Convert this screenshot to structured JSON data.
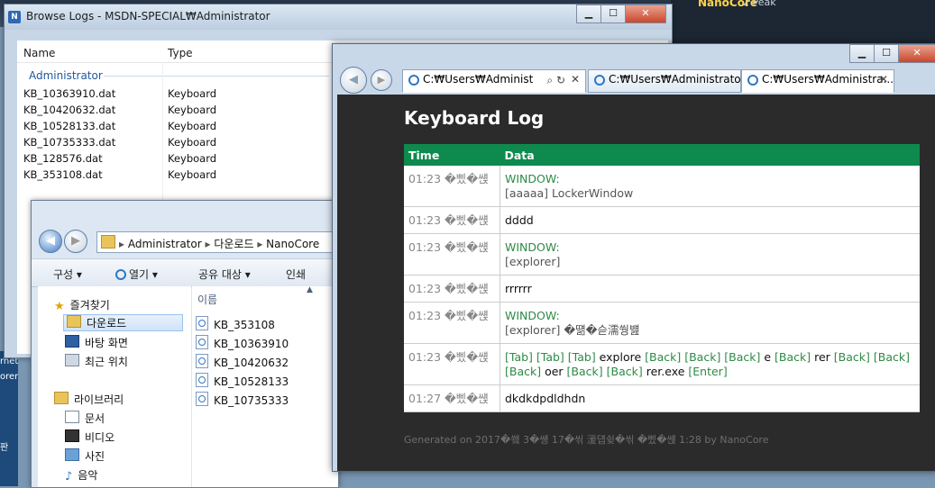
{
  "background": {
    "taskbar_text": "NanoCore",
    "taskbar_text2": "2 Peak",
    "left_labels": [
      "rnet",
      "orer",
      "판"
    ]
  },
  "logs_window": {
    "title": "Browse Logs - MSDN-SPECIAL₩Administrator",
    "app_icon": "N",
    "columns": [
      "Name",
      "Type"
    ],
    "group": "Administrator",
    "rows": [
      {
        "name": "KB_10363910.dat",
        "type": "Keyboard"
      },
      {
        "name": "KB_10420632.dat",
        "type": "Keyboard"
      },
      {
        "name": "KB_10528133.dat",
        "type": "Keyboard"
      },
      {
        "name": "KB_10735333.dat",
        "type": "Keyboard"
      },
      {
        "name": "KB_128576.dat",
        "type": "Keyboard"
      },
      {
        "name": "KB_353108.dat",
        "type": "Keyboard"
      }
    ]
  },
  "explorer": {
    "address": [
      "Administrator",
      "다운로드",
      "NanoCore"
    ],
    "toolbar": [
      "구성 ▾",
      "열기 ▾",
      "공유 대상 ▾",
      "인쇄"
    ],
    "column_header": "이름",
    "nav": [
      {
        "label": "즐겨찾기",
        "icon": "star-icon"
      },
      {
        "label": "다운로드",
        "icon": "folder-icon"
      },
      {
        "label": "바탕 화면",
        "icon": "desktop-icon"
      },
      {
        "label": "최근 위치",
        "icon": "recent-icon"
      },
      {
        "label": "라이브러리",
        "icon": "library-icon"
      },
      {
        "label": "문서",
        "icon": "document-icon"
      },
      {
        "label": "비디오",
        "icon": "video-icon"
      },
      {
        "label": "사진",
        "icon": "picture-icon"
      },
      {
        "label": "음악",
        "icon": "music-icon"
      }
    ],
    "files": [
      "KB_353108",
      "KB_10363910",
      "KB_10420632",
      "KB_10528133",
      "KB_10735333"
    ]
  },
  "ie": {
    "address": "C:₩Users₩Administ",
    "tabs": [
      "C:₩Users₩Administrator...",
      "C:₩Users₩Administra..."
    ],
    "page_title": "Keyboard Log",
    "columns": [
      "Time",
      "Data"
    ],
    "footer": "Generated on 2017�쐨 3�썡 17�씪 湲덉슂�씪 �삤�썑 1:28 by NanoCore"
  }
}
